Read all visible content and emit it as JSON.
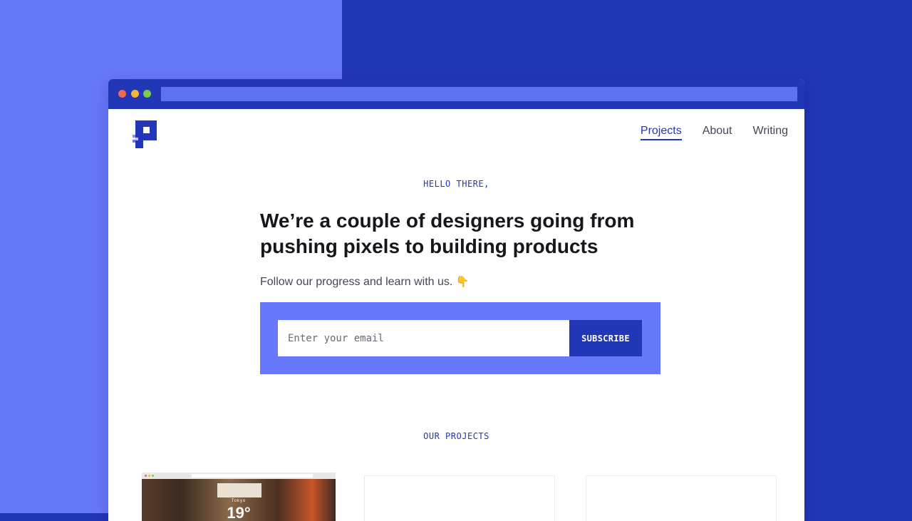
{
  "nav": {
    "items": [
      "Projects",
      "About",
      "Writing"
    ],
    "active": "Projects"
  },
  "hero": {
    "eyebrow": "HELLO THERE,",
    "headline": "We’re a couple of designers going from pushing pixels to building products",
    "lead": "Follow our progress and learn with us.",
    "lead_emoji": "👇"
  },
  "subscribe": {
    "placeholder": "Enter your email",
    "button_label": "SUBSCRIBE"
  },
  "projects": {
    "eyebrow": "OUR PROJECTS",
    "card1": {
      "caption": "Tokyo",
      "temp": "19°"
    }
  },
  "colors": {
    "primary": "#2236b8",
    "accent": "#6878fb",
    "white": "#ffffff"
  },
  "icons": [
    "logo-icon",
    "window-close-dot",
    "window-minimize-dot",
    "window-maximize-dot",
    "pointing-down-emoji"
  ]
}
